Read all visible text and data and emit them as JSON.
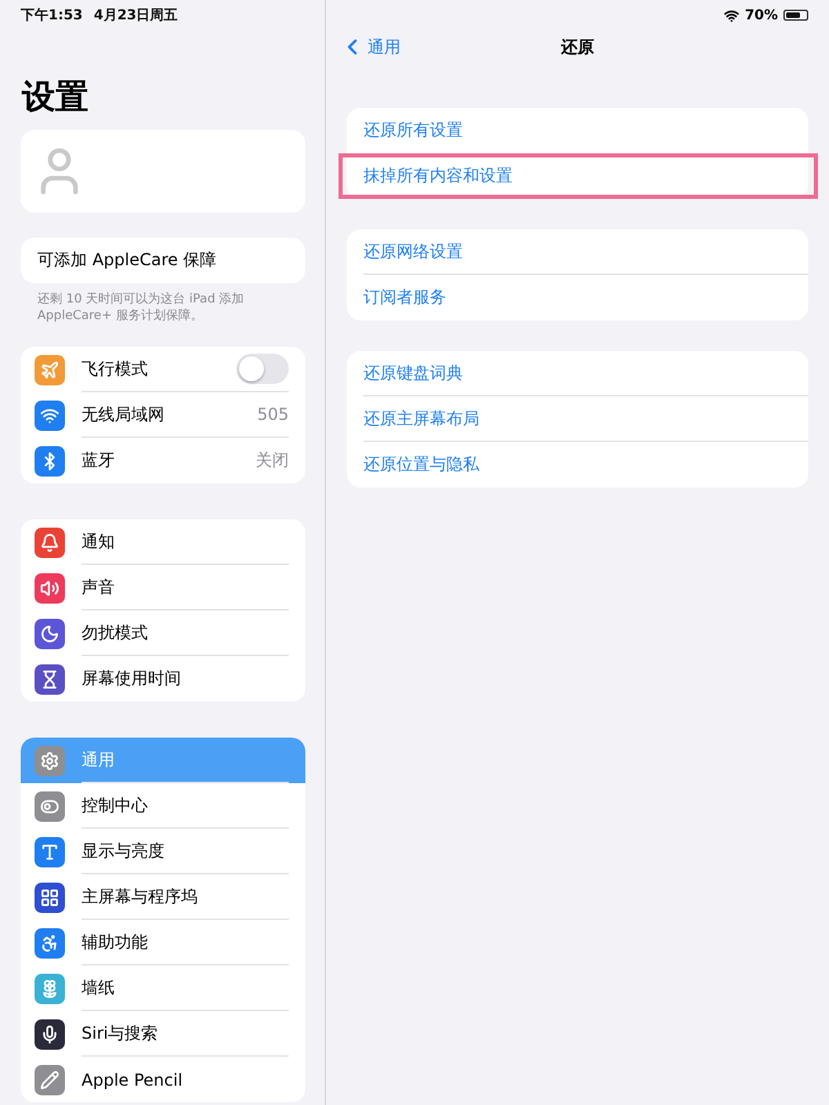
{
  "status_bar": {
    "time": "下午1:53",
    "date": "4月23日周五",
    "battery": "70%"
  },
  "sidebar": {
    "title": "设置",
    "applecare": {
      "label": "可添加 AppleCare 保障",
      "note": "还剩 10 天时间可以为这台 iPad 添加 AppleCare+ 服务计划保障。"
    },
    "groups": [
      {
        "items": [
          {
            "label": "飞行模式",
            "color": "#f29a38",
            "kind": "toggle",
            "on": false,
            "selected": false
          },
          {
            "label": "无线局域网",
            "color": "#1f7ff0",
            "kind": "value",
            "value": "505",
            "selected": false
          },
          {
            "label": "蓝牙",
            "color": "#1f7ff0",
            "kind": "value",
            "value": "关闭",
            "selected": false
          }
        ]
      },
      {
        "items": [
          {
            "label": "通知",
            "color": "#ea4335",
            "kind": "link",
            "selected": false
          },
          {
            "label": "声音",
            "color": "#ee3a5c",
            "kind": "link",
            "selected": false
          },
          {
            "label": "勿扰模式",
            "color": "#5b56d6",
            "kind": "link",
            "selected": false
          },
          {
            "label": "屏幕使用时间",
            "color": "#5b4fc4",
            "kind": "link",
            "selected": false
          }
        ]
      },
      {
        "items": [
          {
            "label": "通用",
            "color": "#8e8e93",
            "kind": "link",
            "selected": true
          },
          {
            "label": "控制中心",
            "color": "#8e8e93",
            "kind": "link",
            "selected": false
          },
          {
            "label": "显示与亮度",
            "color": "#1f7ff0",
            "kind": "link",
            "selected": false
          },
          {
            "label": "主屏幕与程序坞",
            "color": "#2f4fd0",
            "kind": "link",
            "selected": false
          },
          {
            "label": "辅助功能",
            "color": "#1f7ff0",
            "kind": "link",
            "selected": false
          },
          {
            "label": "墙纸",
            "color": "#39b2d6",
            "kind": "link",
            "selected": false
          },
          {
            "label": "Siri与搜索",
            "color": "#2a2a3a",
            "kind": "link",
            "selected": false
          },
          {
            "label": "Apple Pencil",
            "color": "#8e8e93",
            "kind": "link",
            "selected": false
          }
        ]
      }
    ]
  },
  "detail": {
    "back": "通用",
    "title": "还原",
    "groups": [
      {
        "items": [
          {
            "label": "还原所有设置",
            "highlighted": false
          },
          {
            "label": "抹掉所有内容和设置",
            "highlighted": true
          }
        ]
      },
      {
        "items": [
          {
            "label": "还原网络设置",
            "highlighted": false
          },
          {
            "label": "订阅者服务",
            "highlighted": false
          }
        ]
      },
      {
        "items": [
          {
            "label": "还原键盘词典",
            "highlighted": false
          },
          {
            "label": "还原主屏幕布局",
            "highlighted": false
          },
          {
            "label": "还原位置与隐私",
            "highlighted": false
          }
        ]
      }
    ]
  }
}
